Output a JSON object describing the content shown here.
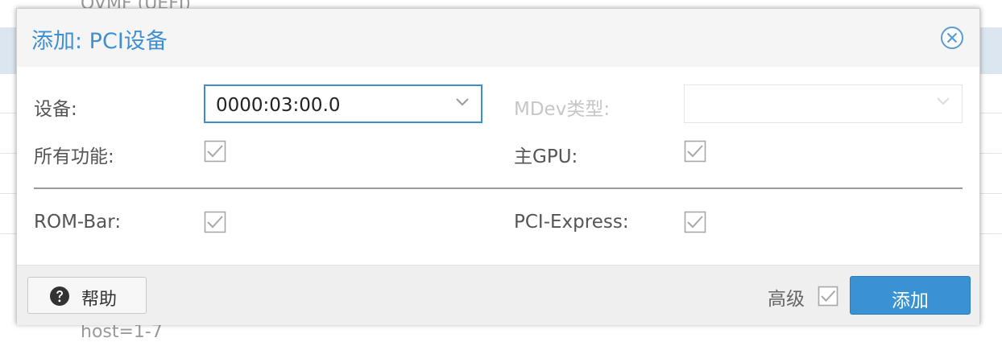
{
  "background": {
    "top_partial_text": "OVMF (UEFI)",
    "bottom_partial_text": "host=1-7"
  },
  "dialog": {
    "title": "添加: PCI设备",
    "close_icon": "close-circle-icon"
  },
  "form": {
    "device_label": "设备:",
    "device_value": "0000:03:00.0",
    "mdev_label": "MDev类型:",
    "mdev_value": "",
    "all_functions_label": "所有功能:",
    "all_functions_checked": true,
    "primary_gpu_label": "主GPU:",
    "primary_gpu_checked": true,
    "rombar_label": "ROM-Bar:",
    "rombar_checked": true,
    "pcie_label": "PCI-Express:",
    "pcie_checked": true
  },
  "footer": {
    "help_label": "帮助",
    "help_icon": "question-circle-icon",
    "advanced_label": "高级",
    "advanced_checked": true,
    "add_label": "添加"
  },
  "colors": {
    "accent": "#3f8fd2",
    "primary_button": "#3892d4",
    "checkbox_disabled": "#a8a8a8"
  }
}
